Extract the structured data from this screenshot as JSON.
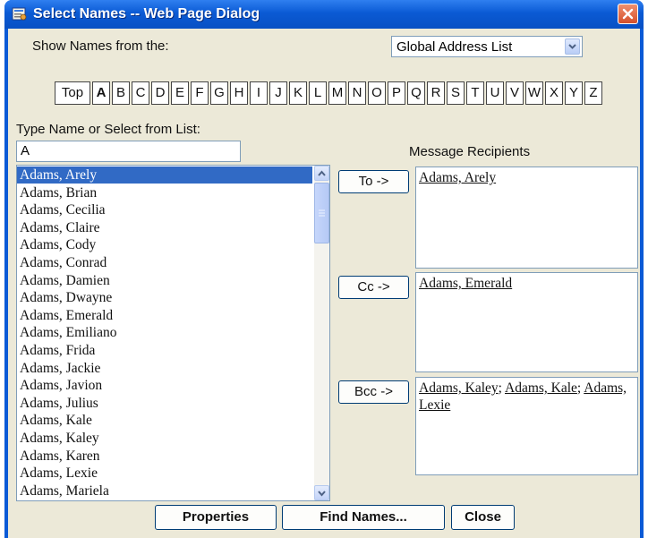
{
  "window": {
    "title": "Select Names -- Web Page Dialog"
  },
  "source": {
    "label": "Show Names from the:",
    "selected": "Global Address List"
  },
  "alphabet": [
    "Top",
    "A",
    "B",
    "C",
    "D",
    "E",
    "F",
    "G",
    "H",
    "I",
    "J",
    "K",
    "L",
    "M",
    "N",
    "O",
    "P",
    "Q",
    "R",
    "S",
    "T",
    "U",
    "V",
    "W",
    "X",
    "Y",
    "Z"
  ],
  "search": {
    "label": "Type Name or Select from List:",
    "value": "A"
  },
  "names": [
    "Adams, Arely",
    "Adams, Brian",
    "Adams, Cecilia",
    "Adams, Claire",
    "Adams, Cody",
    "Adams, Conrad",
    "Adams, Damien",
    "Adams, Dwayne",
    "Adams, Emerald",
    "Adams, Emiliano",
    "Adams, Frida",
    "Adams, Jackie",
    "Adams, Javion",
    "Adams, Julius",
    "Adams, Kale",
    "Adams, Kaley",
    "Adams, Karen",
    "Adams, Lexie",
    "Adams, Mariela"
  ],
  "selected_name": "Adams, Arely",
  "recipients": {
    "heading": "Message Recipients",
    "to": {
      "button": "To ->",
      "names": [
        "Adams, Arely"
      ]
    },
    "cc": {
      "button": "Cc ->",
      "names": [
        "Adams, Emerald"
      ]
    },
    "bcc": {
      "button": "Bcc ->",
      "names": [
        "Adams, Kaley",
        "Adams, Kale",
        "Adams, Lexie"
      ]
    }
  },
  "buttons": {
    "properties": "Properties",
    "find": "Find Names...",
    "close": "Close"
  },
  "colors": {
    "titlebar": "#0a5ad4",
    "selection": "#316ac5",
    "face": "#ece9d8",
    "close": "#d4502c"
  }
}
